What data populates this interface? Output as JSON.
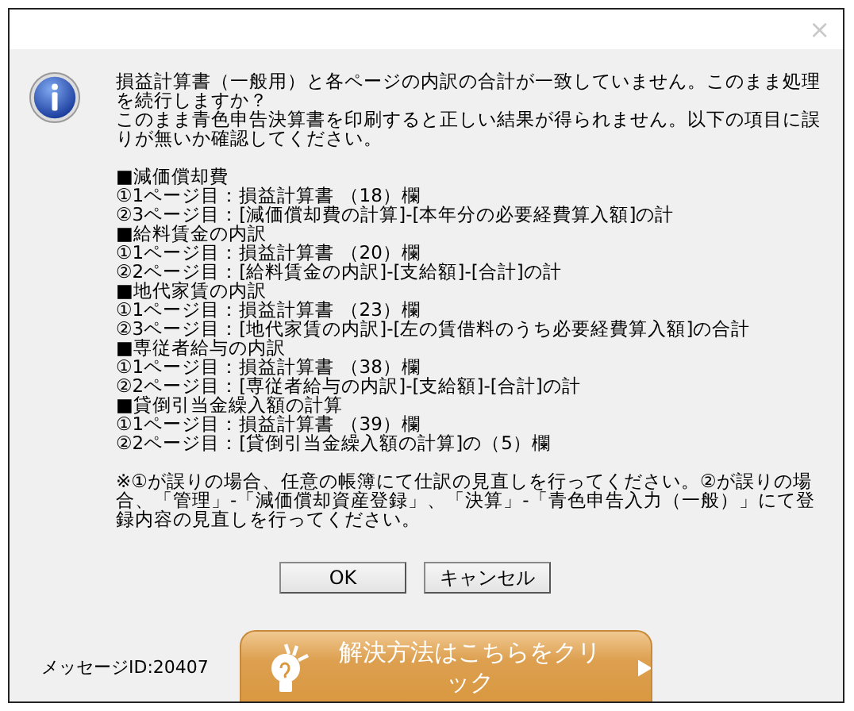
{
  "window": {
    "close": "×"
  },
  "message": {
    "paragraphs": [
      "損益計算書（一般用）と各ページの内訳の合計が一致していません。このまま処理を続行しますか？",
      "このまま青色申告決算書を印刷すると正しい結果が得られません。以下の項目に誤りが無いか確認してください。"
    ],
    "sections": [
      {
        "heading": "■減価償却費",
        "lines": [
          "①1ページ目：損益計算書 （18）欄",
          "②3ページ目：[減価償却費の計算]-[本年分の必要経費算入額]の計"
        ]
      },
      {
        "heading": "■給料賃金の内訳",
        "lines": [
          "①1ページ目：損益計算書 （20）欄",
          "②2ページ目：[給料賃金の内訳]-[支給額]-[合計]の計"
        ]
      },
      {
        "heading": "■地代家賃の内訳",
        "lines": [
          "①1ページ目：損益計算書 （23）欄",
          "②3ページ目：[地代家賃の内訳]-[左の賃借料のうち必要経費算入額]の合計"
        ]
      },
      {
        "heading": "■専従者給与の内訳",
        "lines": [
          "①1ページ目：損益計算書 （38）欄",
          "②2ページ目：[専従者給与の内訳]-[支給額]-[合計]の計"
        ]
      },
      {
        "heading": "■貸倒引当金繰入額の計算",
        "lines": [
          "①1ページ目：損益計算書 （39）欄",
          "②2ページ目：[貸倒引当金繰入額の計算]の（5）欄"
        ]
      }
    ],
    "note": "※①が誤りの場合、任意の帳簿にて仕訳の見直しを行ってください。②が誤りの場合、「管理」-「減価償却資産登録」、「決算」-「青色申告入力（一般）」にて登録内容の見直しを行ってください。"
  },
  "buttons": [
    "OK",
    "キャンセル"
  ],
  "message_id": "メッセージID:20407",
  "help_button": "解決方法はこちらをクリック"
}
